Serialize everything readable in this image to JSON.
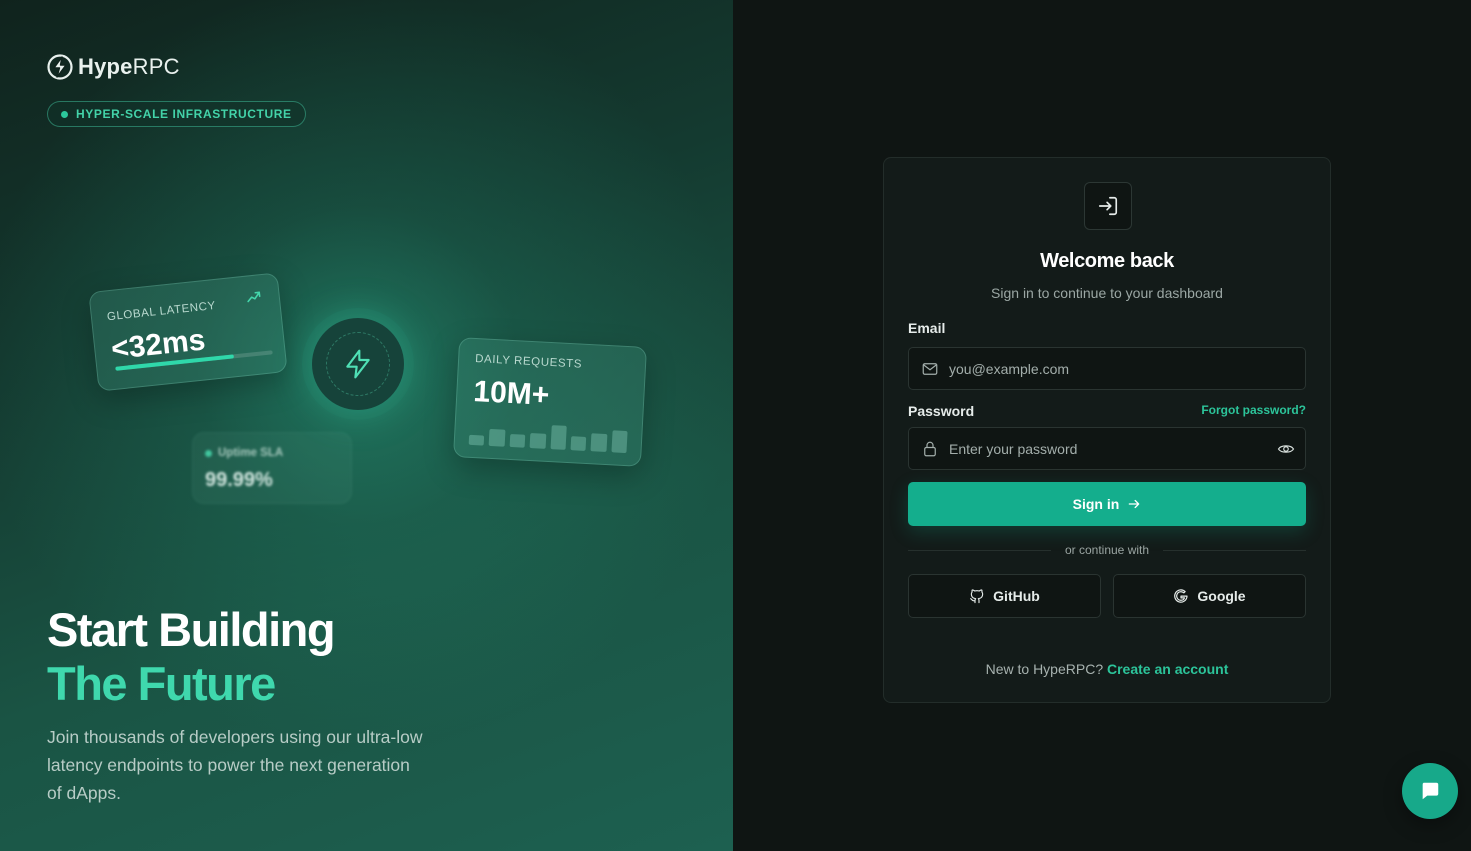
{
  "brand": {
    "name_bold": "Hype",
    "name_light": "RPC"
  },
  "hero": {
    "tagline": "HYPER-SCALE INFRASTRUCTURE",
    "title_line1": "Start Building",
    "title_line2": "The Future",
    "subtitle": "Join thousands of developers using our ultra-low latency endpoints to power the next generation of dApps."
  },
  "stats": {
    "latency": {
      "label": "GLOBAL LATENCY",
      "value": "<32ms",
      "progress": 0.75
    },
    "requests": {
      "label": "DAILY REQUESTS",
      "value": "10M+",
      "bars": [
        0.35,
        0.6,
        0.45,
        0.55,
        0.85,
        0.5,
        0.65,
        0.8
      ]
    },
    "uptime": {
      "label": "Uptime SLA",
      "value": "99.99%"
    }
  },
  "login": {
    "title": "Welcome back",
    "subtitle": "Sign in to continue to your dashboard",
    "email_label": "Email",
    "email_placeholder": "you@example.com",
    "password_label": "Password",
    "forgot_label": "Forgot password?",
    "password_placeholder": "Enter your password",
    "signin_label": "Sign in",
    "divider_text": "or continue with",
    "github_label": "GitHub",
    "google_label": "Google",
    "footer_text": "New to HypeRPC?",
    "footer_link": "Create an account"
  },
  "icons": {
    "logo": "bolt-circle-icon",
    "trend": "trending-up-icon",
    "center": "lightning-bolt-icon",
    "login": "log-in-icon",
    "email": "mail-icon",
    "password": "lock-icon",
    "reveal": "eye-icon",
    "signin": "arrow-right-icon",
    "github": "github-icon",
    "google": "google-icon",
    "chat": "chat-bubble-icon"
  },
  "colors": {
    "accent": "#14ae8d",
    "accent_text": "#2cc49a",
    "hero_highlight": "#3fd8ad"
  }
}
